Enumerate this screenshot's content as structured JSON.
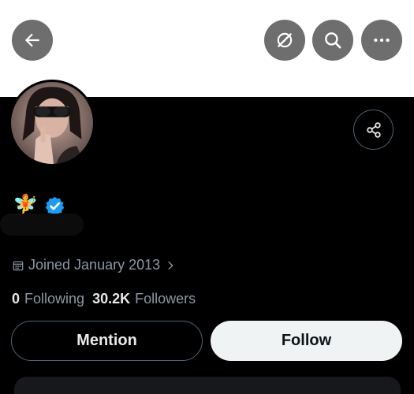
{
  "header": {
    "back_icon": "arrow-left-icon",
    "grok_icon": "grok-icon",
    "search_icon": "search-icon",
    "more_icon": "more-dots-icon",
    "button_color": "#6e6e6e"
  },
  "profile": {
    "emoji": "🧚",
    "verified_color": "#1d9bf0",
    "joined": "Joined January 2013",
    "following_count": "0",
    "following_label": "Following",
    "followers_count": "30.2K",
    "followers_label": "Followers"
  },
  "actions": {
    "mention_label": "Mention",
    "follow_label": "Follow"
  }
}
